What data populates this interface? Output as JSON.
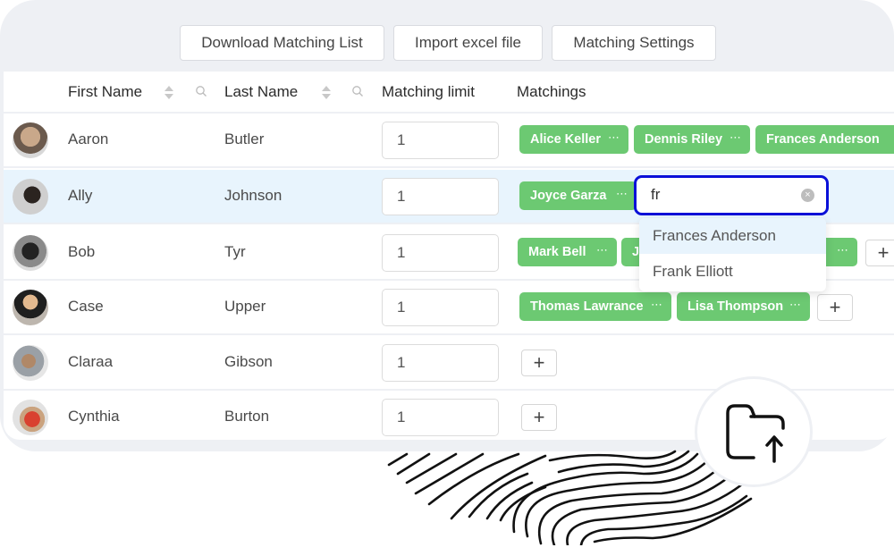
{
  "toolbar": {
    "download_label": "Download Matching List",
    "import_label": "Import excel file",
    "settings_label": "Matching Settings"
  },
  "table": {
    "columns": {
      "first_name": "First Name",
      "last_name": "Last Name",
      "matching_limit": "Matching limit",
      "matchings": "Matchings"
    },
    "rows": [
      {
        "first": "Aaron",
        "last": "Butler",
        "limit": "1",
        "matchings": [
          "Alice Keller",
          "Dennis Riley",
          "Frances Anderson"
        ]
      },
      {
        "first": "Ally",
        "last": "Johnson",
        "limit": "1",
        "matchings": [
          "Joyce Garza"
        ],
        "selected": true
      },
      {
        "first": "Bob",
        "last": "Tyr",
        "limit": "1",
        "matchings": [
          "Mark Bell",
          "J"
        ]
      },
      {
        "first": "Case",
        "last": "Upper",
        "limit": "1",
        "matchings": [
          "Thomas Lawrance",
          "Lisa Thompson"
        ]
      },
      {
        "first": "Claraa",
        "last": "Gibson",
        "limit": "1",
        "matchings": []
      },
      {
        "first": "Cynthia",
        "last": "Burton",
        "limit": "1",
        "matchings": []
      }
    ]
  },
  "match_search": {
    "value": "fr",
    "results": [
      "Frances Anderson",
      "Frank Elliott"
    ],
    "highlighted_index": 0
  },
  "icons": {
    "more": "⋯",
    "add": "+",
    "clear": "×"
  },
  "colors": {
    "tag_green": "#6cc972",
    "focus_blue": "#0a10d8",
    "row_highlight": "#e8f4fd"
  }
}
